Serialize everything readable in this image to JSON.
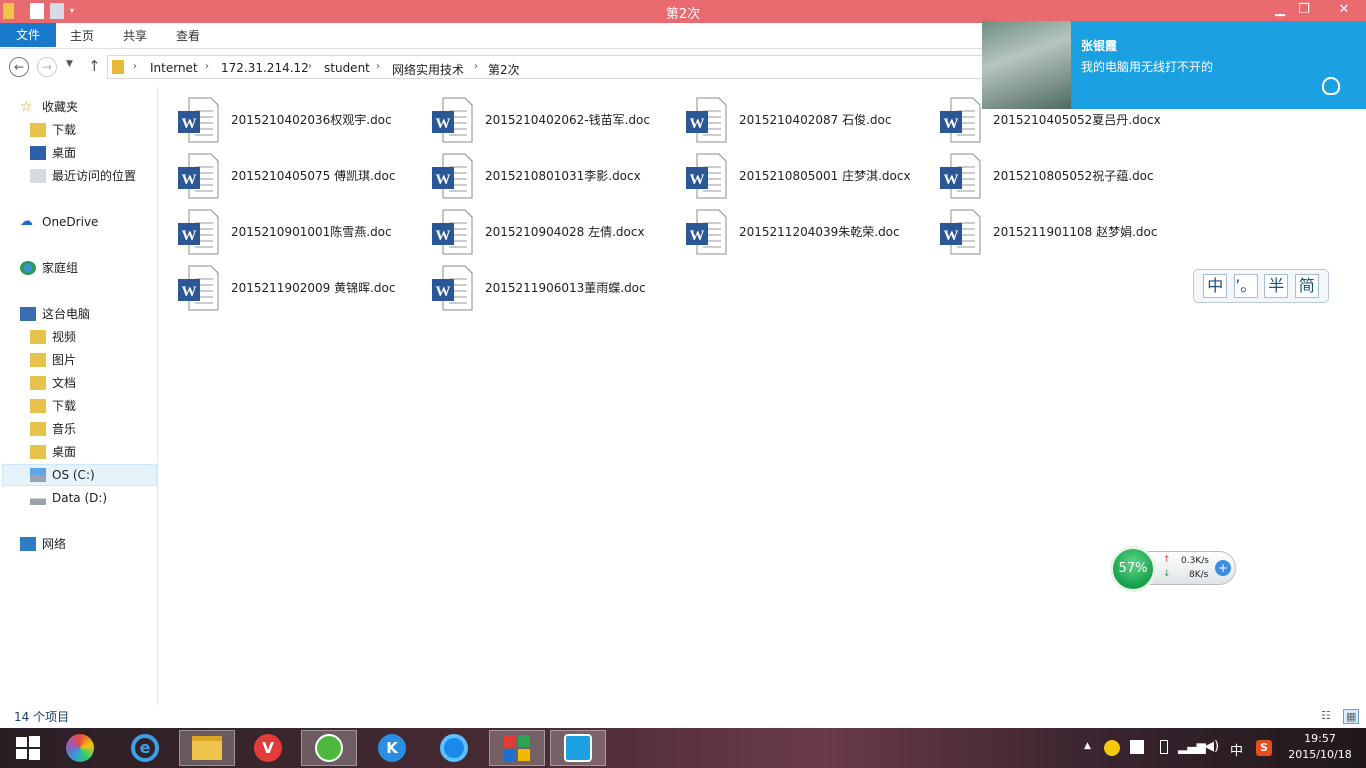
{
  "window": {
    "title": "第2次",
    "minimize": "▁",
    "restore": "❐",
    "close": "✕"
  },
  "ribbon": {
    "file_tab": "文件",
    "tabs": [
      "主页",
      "共享",
      "查看"
    ]
  },
  "address": {
    "crumbs": [
      "Internet",
      "172.31.214.12",
      "student",
      "网络实用技术",
      "第2次"
    ]
  },
  "nav": {
    "favorites": "收藏夹",
    "downloads": "下载",
    "desktop": "桌面",
    "recent": "最近访问的位置",
    "onedrive": "OneDrive",
    "homegroup": "家庭组",
    "thispc": "这台电脑",
    "videos": "视频",
    "pictures": "图片",
    "documents": "文档",
    "downloads2": "下载",
    "music": "音乐",
    "desktop2": "桌面",
    "os_drive": "OS (C:)",
    "data_drive": "Data (D:)",
    "network": "网络"
  },
  "files": [
    "2015210402036权观宇.doc",
    "2015210402062-钱苗军.doc",
    "2015210402087 石俊.doc",
    "2015210405052夏吕丹.docx",
    "2015210405075 傅凯琪.doc",
    "2015210801031李影.docx",
    "2015210805001  庄梦淇.docx",
    "2015210805052祝子蕴.doc",
    "2015210901001陈雪燕.doc",
    "2015210904028 左倩.docx",
    "2015211204039朱乾荣.doc",
    "2015211901108  赵梦娟.doc",
    "2015211902009 黄锦晖.doc",
    "2015211906013董雨蝶.doc"
  ],
  "status": {
    "item_count": "14 个项目"
  },
  "notification": {
    "sender": "张银霞",
    "message": "我的电脑用无线打不开的"
  },
  "ime": {
    "chars": [
      "中",
      "’。",
      "半",
      "简"
    ]
  },
  "netmon": {
    "percent": "57%",
    "upload": "0.3K/s",
    "download": "8K/s"
  },
  "clock": {
    "time": "19:57",
    "date": "2015/10/18"
  },
  "tray": {
    "ime_indicator": "中"
  }
}
